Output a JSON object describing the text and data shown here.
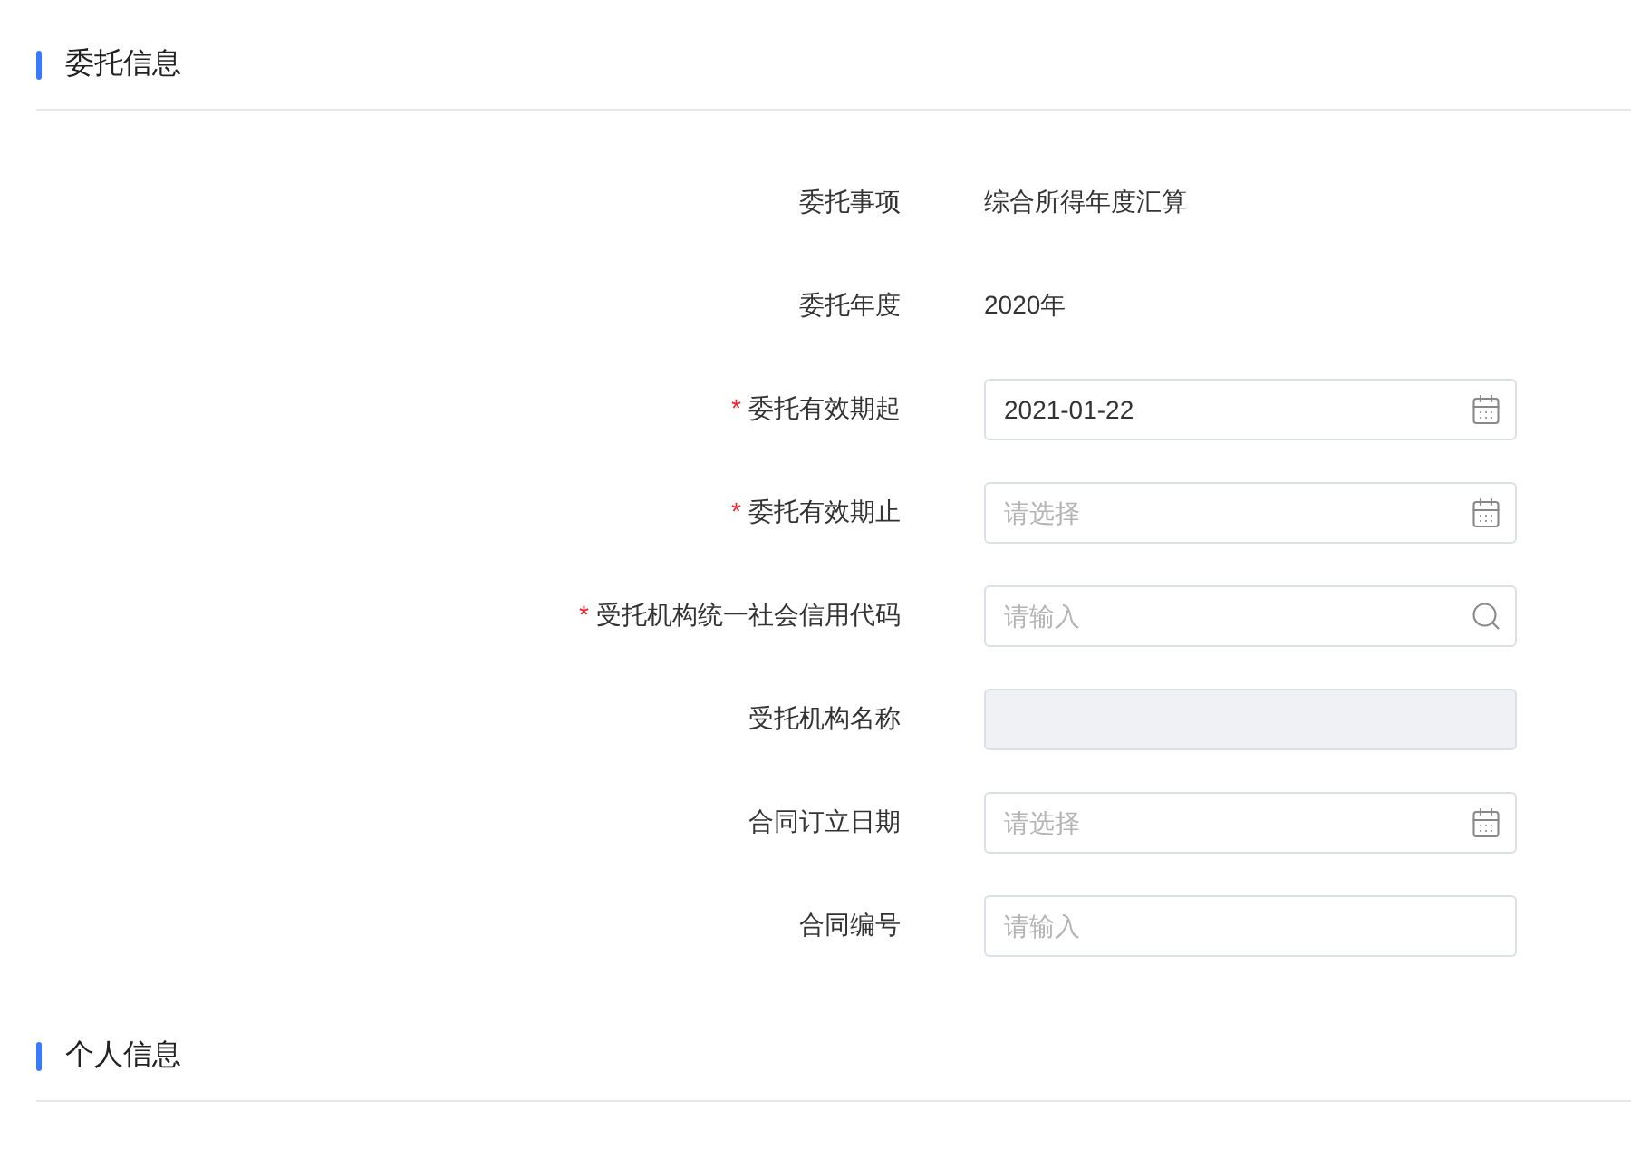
{
  "sections": [
    {
      "title": "委托信息",
      "fields": [
        {
          "label": "委托事项",
          "kind": "static",
          "value": "综合所得年度汇算"
        },
        {
          "label": "委托年度",
          "kind": "static",
          "value": "2020年"
        },
        {
          "label": "委托有效期起",
          "kind": "date",
          "required_mark": "*",
          "value": "2021-01-22"
        },
        {
          "label": "委托有效期止",
          "kind": "date",
          "required_mark": "*",
          "placeholder": "请选择"
        },
        {
          "label": "受托机构统一社会信用代码",
          "kind": "search",
          "required_mark": "*",
          "placeholder": "请输入"
        },
        {
          "label": "受托机构名称",
          "kind": "disabled"
        },
        {
          "label": "合同订立日期",
          "kind": "date",
          "placeholder": "请选择"
        },
        {
          "label": "合同编号",
          "kind": "input",
          "placeholder": "请输入"
        }
      ]
    },
    {
      "title": "个人信息"
    }
  ]
}
